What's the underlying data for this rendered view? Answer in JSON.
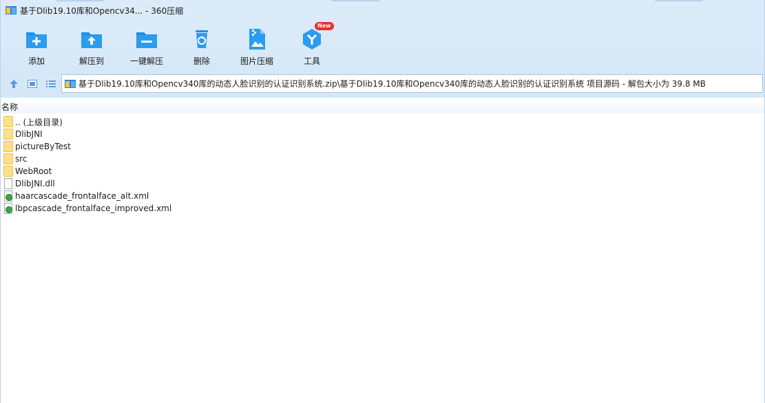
{
  "window": {
    "title": "基于Dlib19.10库和Opencv34... - 360压缩"
  },
  "toolbar": {
    "items": [
      {
        "label": "添加",
        "icon": "add-folder-icon"
      },
      {
        "label": "解压到",
        "icon": "extract-to-icon"
      },
      {
        "label": "一键解压",
        "icon": "one-click-extract-icon"
      },
      {
        "label": "删除",
        "icon": "recycle-bin-icon"
      },
      {
        "label": "图片压缩",
        "icon": "image-compress-icon"
      },
      {
        "label": "工具",
        "icon": "tools-icon",
        "badge": "New"
      }
    ]
  },
  "address": {
    "path": "基于Dlib19.10库和Opencv340库的动态人脸识别的认证识别系统.zip\\基于Dlib19.10库和Opencv340库的动态人脸识别的认证识别系统 项目源码 - 解包大小为 39.8 MB"
  },
  "list": {
    "column_name": "名称",
    "rows": [
      {
        "name": ".. (上级目录)",
        "type": "folder"
      },
      {
        "name": "DlibJNI",
        "type": "folder"
      },
      {
        "name": "pictureByTest",
        "type": "folder"
      },
      {
        "name": "src",
        "type": "folder"
      },
      {
        "name": "WebRoot",
        "type": "folder"
      },
      {
        "name": "DlibJNI.dll",
        "type": "file"
      },
      {
        "name": "haarcascade_frontalface_alt.xml",
        "type": "xml"
      },
      {
        "name": "lbpcascade_frontalface_improved.xml",
        "type": "xml"
      }
    ]
  },
  "colors": {
    "toolbar_bg": "#dcebf9",
    "accent_blue": "#1f8ee6",
    "badge_red": "#e8322c"
  }
}
